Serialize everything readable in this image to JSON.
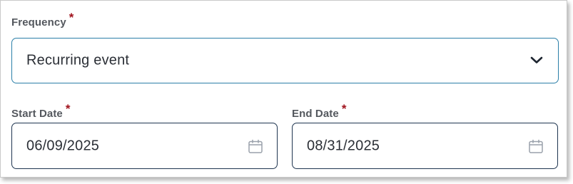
{
  "frequency": {
    "label": "Frequency",
    "required_mark": "*",
    "value": "Recurring event"
  },
  "start_date": {
    "label": "Start Date",
    "required_mark": "*",
    "value": "06/09/2025"
  },
  "end_date": {
    "label": "End Date",
    "required_mark": "*",
    "value": "08/31/2025"
  },
  "icons": {
    "dropdown": "chevron-down-icon",
    "date_picker": "calendar-icon"
  },
  "colors": {
    "required": "#a0121c",
    "select_border": "#2b7fa8",
    "date_border": "#1f3550",
    "label": "#54585e",
    "text": "#2b2f36"
  }
}
